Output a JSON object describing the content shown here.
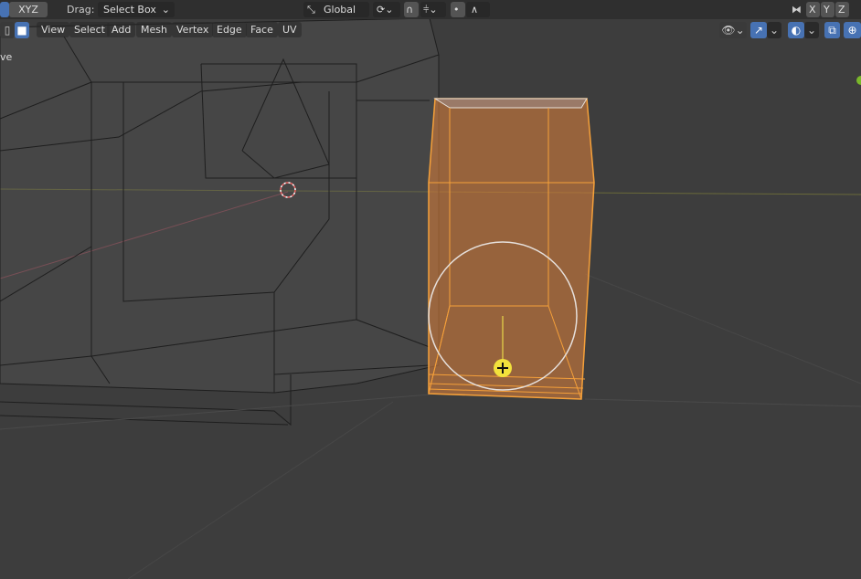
{
  "header": {
    "axis_label": "XYZ",
    "drag_label": "Drag:",
    "drag_value": "Select Box",
    "orientation_value": "Global",
    "mirror_axes": [
      "X",
      "Y",
      "Z"
    ]
  },
  "menu": {
    "items": [
      "View",
      "Select",
      "Add",
      "Mesh",
      "Vertex",
      "Edge",
      "Face",
      "UV"
    ]
  },
  "mode_text": "ve",
  "colors": {
    "selection": "#f5a03a",
    "background": "#3d3d3d",
    "accent": "#4772b3"
  }
}
